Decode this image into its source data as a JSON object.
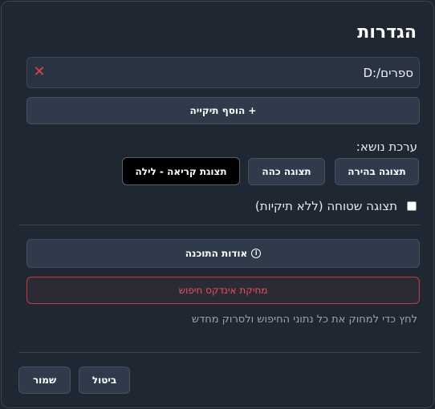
{
  "dialog": {
    "title": "הגדרות"
  },
  "folders": {
    "items": [
      {
        "path": "D:/ספרים",
        "remove_icon": "close-icon"
      }
    ],
    "add_label": "+ הוסף תיקייה"
  },
  "theme": {
    "label": "ערכת נושא:",
    "options": [
      {
        "label": "תצוגה בהירה",
        "selected": false
      },
      {
        "label": "תצוגה כהה",
        "selected": false
      },
      {
        "label": "תצוגת קריאה - לילה",
        "selected": true
      }
    ]
  },
  "flat_view": {
    "label": "תצוגה שטוחה (ללא תיקיות)",
    "checked": false
  },
  "about": {
    "label": "אודות התוכנה",
    "icon": "info-icon"
  },
  "search_index": {
    "clear_label": "מחיקת אינדקס חיפוש",
    "hint": "לחץ כדי למחוק את כל נתוני החיפוש ולסרוק מחדש"
  },
  "footer": {
    "cancel_label": "ביטול",
    "save_label": "שמור"
  },
  "colors": {
    "background": "#1f2733",
    "button": "#2f3a4a",
    "danger": "#e4545c",
    "selected_theme": "#000000"
  }
}
